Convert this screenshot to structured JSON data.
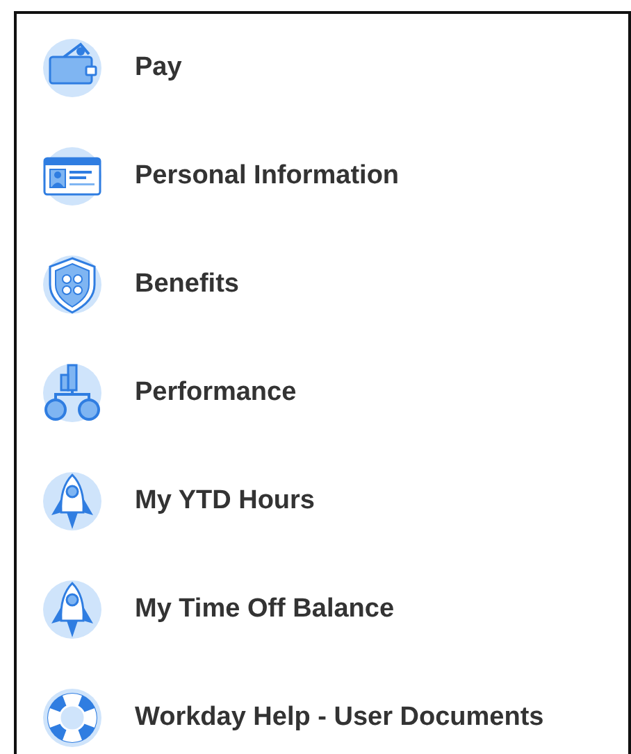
{
  "menu_items": [
    {
      "label": "Pay",
      "kind": "wallet"
    },
    {
      "label": "Personal Information",
      "kind": "id-card"
    },
    {
      "label": "Benefits",
      "kind": "shield"
    },
    {
      "label": "Performance",
      "kind": "org-chart"
    },
    {
      "label": "My YTD Hours",
      "kind": "rocket"
    },
    {
      "label": "My Time Off Balance",
      "kind": "rocket"
    },
    {
      "label": "Workday Help - User Documents",
      "kind": "lifebuoy"
    }
  ]
}
